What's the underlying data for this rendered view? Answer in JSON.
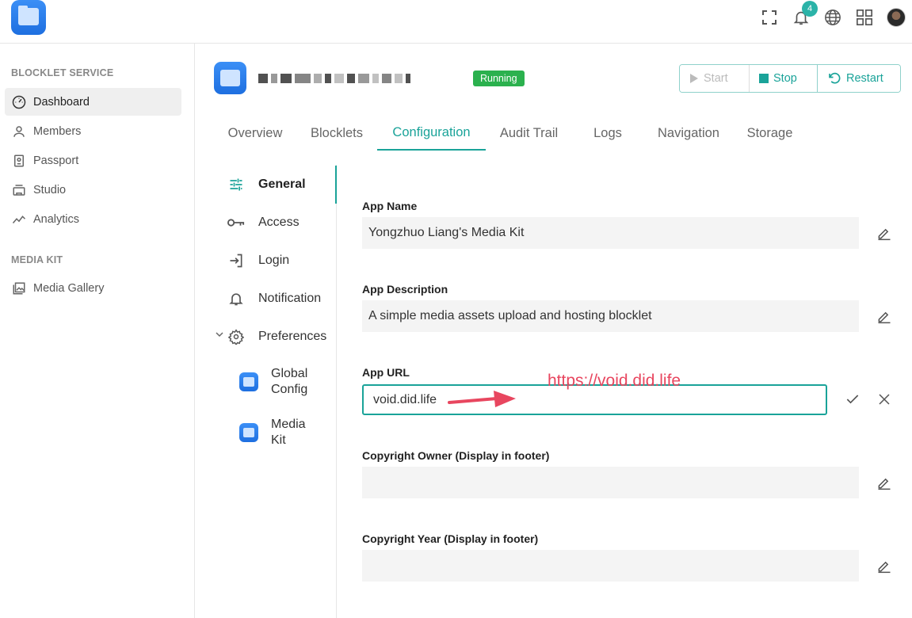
{
  "topbar": {
    "notification_count": "4",
    "icons": [
      "fullscreen-icon",
      "bell-icon",
      "globe-icon",
      "apps-icon"
    ]
  },
  "sidebar": {
    "sections": [
      {
        "title": "BLOCKLET SERVICE",
        "items": [
          {
            "label": "Dashboard",
            "icon": "dashboard-icon",
            "active": true
          },
          {
            "label": "Members",
            "icon": "person-icon"
          },
          {
            "label": "Passport",
            "icon": "passport-icon"
          },
          {
            "label": "Studio",
            "icon": "studio-icon"
          },
          {
            "label": "Analytics",
            "icon": "analytics-icon"
          }
        ]
      },
      {
        "title": "MEDIA KIT",
        "items": [
          {
            "label": "Media Gallery",
            "icon": "gallery-icon"
          }
        ]
      }
    ]
  },
  "header": {
    "status": "Running",
    "status_color": "#2bb14e",
    "buttons": {
      "start": "Start",
      "stop": "Stop",
      "restart": "Restart"
    }
  },
  "tabs": [
    "Overview",
    "Blocklets",
    "Configuration",
    "Audit Trail",
    "Logs",
    "Navigation",
    "Storage"
  ],
  "active_tab": "Configuration",
  "config_menu": {
    "items": [
      {
        "label": "General",
        "icon": "sliders-icon",
        "active": true
      },
      {
        "label": "Access",
        "icon": "key-icon"
      },
      {
        "label": "Login",
        "icon": "login-icon"
      },
      {
        "label": "Notification",
        "icon": "bell-icon"
      },
      {
        "label": "Preferences",
        "icon": "gear-icon",
        "expanded": true
      }
    ],
    "sub_items": [
      {
        "line1": "Global",
        "line2": "Config"
      },
      {
        "line1": "Media",
        "line2": "Kit"
      }
    ]
  },
  "form": {
    "app_name": {
      "label": "App Name",
      "value": "Yongzhuo Liang's Media Kit"
    },
    "app_description": {
      "label": "App Description",
      "value": "A simple media assets upload and hosting blocklet"
    },
    "app_url": {
      "label": "App URL",
      "value": "void.did.life"
    },
    "copyright_owner": {
      "label": "Copyright Owner (Display in footer)",
      "value": ""
    },
    "copyright_year": {
      "label": "Copyright Year (Display in footer)",
      "value": ""
    }
  },
  "annotation": {
    "text": "https://void.did.life",
    "color": "#e8465f"
  },
  "accent_color": "#1aa399"
}
